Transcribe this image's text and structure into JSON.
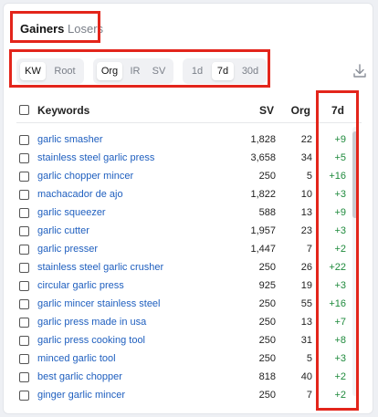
{
  "tabs": {
    "gainers": "Gainers",
    "losers": "Losers"
  },
  "filters": {
    "kw": "KW",
    "root": "Root",
    "org": "Org",
    "ir": "IR",
    "sv": "SV",
    "d1": "1d",
    "d7": "7d",
    "d30": "30d"
  },
  "table": {
    "headers": {
      "keywords": "Keywords",
      "sv": "SV",
      "org": "Org",
      "change": "7d"
    },
    "rows": [
      {
        "keyword": "garlic smasher",
        "sv": "1,828",
        "org": "22",
        "change": "+9"
      },
      {
        "keyword": "stainless steel garlic press",
        "sv": "3,658",
        "org": "34",
        "change": "+5"
      },
      {
        "keyword": "garlic chopper mincer",
        "sv": "250",
        "org": "5",
        "change": "+16"
      },
      {
        "keyword": "machacador de ajo",
        "sv": "1,822",
        "org": "10",
        "change": "+3"
      },
      {
        "keyword": "garlic squeezer",
        "sv": "588",
        "org": "13",
        "change": "+9"
      },
      {
        "keyword": "garlic cutter",
        "sv": "1,957",
        "org": "23",
        "change": "+3"
      },
      {
        "keyword": "garlic presser",
        "sv": "1,447",
        "org": "7",
        "change": "+2"
      },
      {
        "keyword": "stainless steel garlic crusher",
        "sv": "250",
        "org": "26",
        "change": "+22"
      },
      {
        "keyword": "circular garlic press",
        "sv": "925",
        "org": "19",
        "change": "+3"
      },
      {
        "keyword": "garlic mincer stainless steel",
        "sv": "250",
        "org": "55",
        "change": "+16"
      },
      {
        "keyword": "garlic press made in usa",
        "sv": "250",
        "org": "13",
        "change": "+7"
      },
      {
        "keyword": "garlic press cooking tool",
        "sv": "250",
        "org": "31",
        "change": "+8"
      },
      {
        "keyword": "minced garlic tool",
        "sv": "250",
        "org": "5",
        "change": "+3"
      },
      {
        "keyword": "best garlic chopper",
        "sv": "818",
        "org": "40",
        "change": "+2"
      },
      {
        "keyword": "ginger garlic mincer",
        "sv": "250",
        "org": "7",
        "change": "+2"
      }
    ]
  },
  "colors": {
    "highlight": "#e3251b",
    "link": "#1f5fbf",
    "positive": "#1e8a3c"
  },
  "icons": {
    "download": "download-icon"
  }
}
